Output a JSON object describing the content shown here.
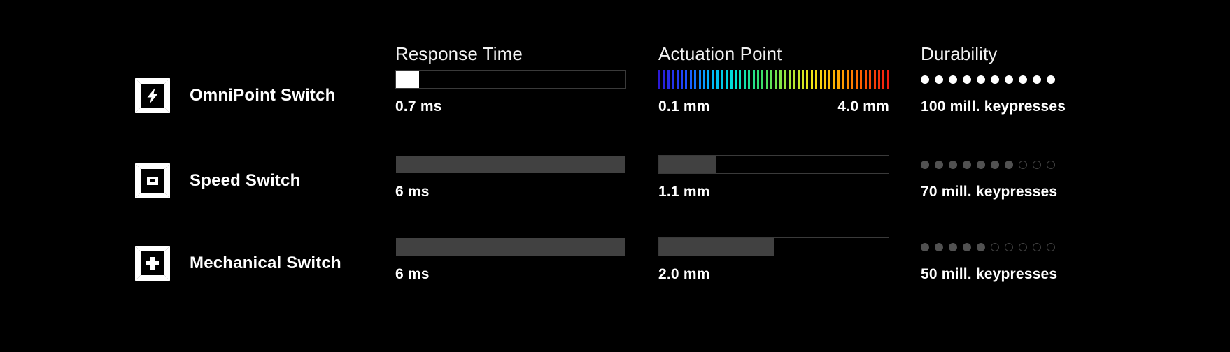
{
  "columns": {
    "switch_label": "",
    "response_time": "Response Time",
    "actuation_point": "Actuation Point",
    "durability": "Durability"
  },
  "colors": {
    "background": "#000000",
    "text": "#ffffff",
    "header_text": "#f2f2f2",
    "bar_track_border": "#3a3a3a",
    "bar_fill_white": "#ffffff",
    "bar_fill_gray": "#414141",
    "dot_active_white": "#ffffff",
    "dot_active_gray": "#515151",
    "dot_inactive": "#414141"
  },
  "rows": [
    {
      "icon": "keycap-lightning-icon",
      "name": "OmniPoint Switch",
      "response_time": {
        "value": "0.7 ms",
        "fill_percent": 10,
        "fill_style": "white",
        "track": true
      },
      "actuation_point": {
        "value_start": "0.1 mm",
        "value_end": "4.0 mm",
        "style": "rainbow",
        "stripe_count": 52,
        "gradient_stops": [
          "#2b1ad6",
          "#1f49ff",
          "#00b4ff",
          "#00e5d0",
          "#34e06a",
          "#9ee63a",
          "#f2e515",
          "#ffae00",
          "#ff5a00",
          "#f01d10"
        ]
      },
      "durability": {
        "text": "100 mill. keypresses",
        "filled": 10,
        "total": 10,
        "dot_style": "white"
      }
    },
    {
      "icon": "keycap-speed-icon",
      "name": "Speed Switch",
      "response_time": {
        "value": "6 ms",
        "fill_percent": 100,
        "fill_style": "gray",
        "track": false
      },
      "actuation_point": {
        "value_start": "1.1 mm",
        "value_end": "",
        "style": "bar",
        "fill_percent": 25,
        "fill_style": "gray",
        "track": true
      },
      "durability": {
        "text": "70 mill. keypresses",
        "filled": 7,
        "total": 10,
        "dot_style": "gray"
      }
    },
    {
      "icon": "keycap-cross-icon",
      "name": "Mechanical Switch",
      "response_time": {
        "value": "6 ms",
        "fill_percent": 100,
        "fill_style": "gray",
        "track": false
      },
      "actuation_point": {
        "value_start": "2.0 mm",
        "value_end": "",
        "style": "bar",
        "fill_percent": 50,
        "fill_style": "gray",
        "track": true
      },
      "durability": {
        "text": "50 mill. keypresses",
        "filled": 5,
        "total": 10,
        "dot_style": "gray"
      }
    }
  ]
}
